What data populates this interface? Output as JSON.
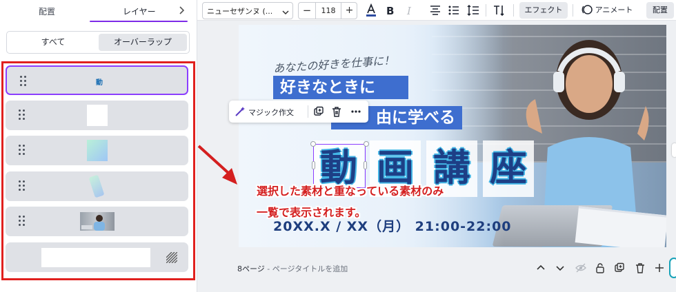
{
  "left_panel": {
    "tabs": [
      {
        "label": "配置"
      },
      {
        "label": "レイヤー"
      }
    ],
    "filter": {
      "all_label": "すべて",
      "overlap_label": "オーバーラップ"
    },
    "layers": [
      {
        "kind": "text",
        "thumb_text": "動",
        "selected": true
      },
      {
        "kind": "white-shape"
      },
      {
        "kind": "gradient-shape"
      },
      {
        "kind": "gradient-sliver"
      },
      {
        "kind": "photo"
      },
      {
        "kind": "background"
      }
    ]
  },
  "toolbar": {
    "font_name": "ニューセザンヌ (...",
    "font_size": "118",
    "minus": "−",
    "plus": "+",
    "effects_label": "エフェクト",
    "animate_label": "アニメート",
    "position_label": "配置",
    "accent_color": "#2d4ba0",
    "icons": [
      "text-color-icon",
      "bold-icon",
      "italic-icon",
      "align-center-icon",
      "bullet-list-icon",
      "line-spacing-icon",
      "vertical-text-icon",
      "animate-icon"
    ]
  },
  "floating_toolbar": {
    "magic_write_label": "マジック作文",
    "icons": [
      "magic-write-icon",
      "duplicate-icon",
      "delete-icon",
      "more-icon"
    ]
  },
  "design": {
    "tagline": "あなたの好きを仕事に！",
    "band1": "好きなときに",
    "band2": "由に学べる",
    "title_chars": [
      "動",
      "画",
      "講",
      "座"
    ],
    "datetime": "20XX.X / XX（月） 21:00-22:00"
  },
  "annotation": {
    "line1": "選択した素材と重なっている素材のみ",
    "line2": "一覧で表示されます。",
    "color": "#d41f1f"
  },
  "page_bar": {
    "page": "8ページ",
    "title_placeholder": " - ページタイトルを追加"
  }
}
